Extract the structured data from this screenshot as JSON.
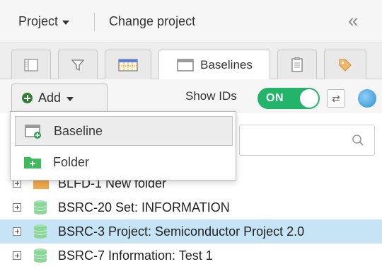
{
  "topbar": {
    "project_label": "Project",
    "change_project_label": "Change project",
    "collapse_glyph": "«"
  },
  "tabs": [
    {
      "icon": "tree-view-icon"
    },
    {
      "icon": "filter-icon"
    },
    {
      "icon": "matrix-icon"
    },
    {
      "icon": "window-icon",
      "label": "Baselines",
      "active": true
    },
    {
      "icon": "clipboard-icon"
    },
    {
      "icon": "tag-icon"
    }
  ],
  "toolbar": {
    "add_label": "Add",
    "show_ids_label": "Show IDs",
    "toggle_state": "ON",
    "refresh_glyph": "⇄"
  },
  "menu": {
    "items": [
      {
        "label": "Baseline",
        "icon": "baseline-icon"
      },
      {
        "label": "Folder",
        "icon": "folder-add-icon"
      }
    ]
  },
  "tree": {
    "rows": [
      {
        "label": "BLFD-1 New folder",
        "icon": "folder-icon",
        "selected": false
      },
      {
        "label": "BSRC-20 Set: INFORMATION",
        "icon": "database-icon",
        "selected": false
      },
      {
        "label": "BSRC-3 Project: Semiconductor Project 2.0",
        "icon": "database-icon",
        "selected": true
      },
      {
        "label": "BSRC-7 Information: Test 1",
        "icon": "database-icon",
        "selected": false
      }
    ]
  },
  "colors": {
    "toggle_on": "#22b46a",
    "selected_row": "#c6e4f5",
    "db_icon": "#8bd79a",
    "folder": "#f1a84a",
    "add_green": "#2e7d32"
  }
}
